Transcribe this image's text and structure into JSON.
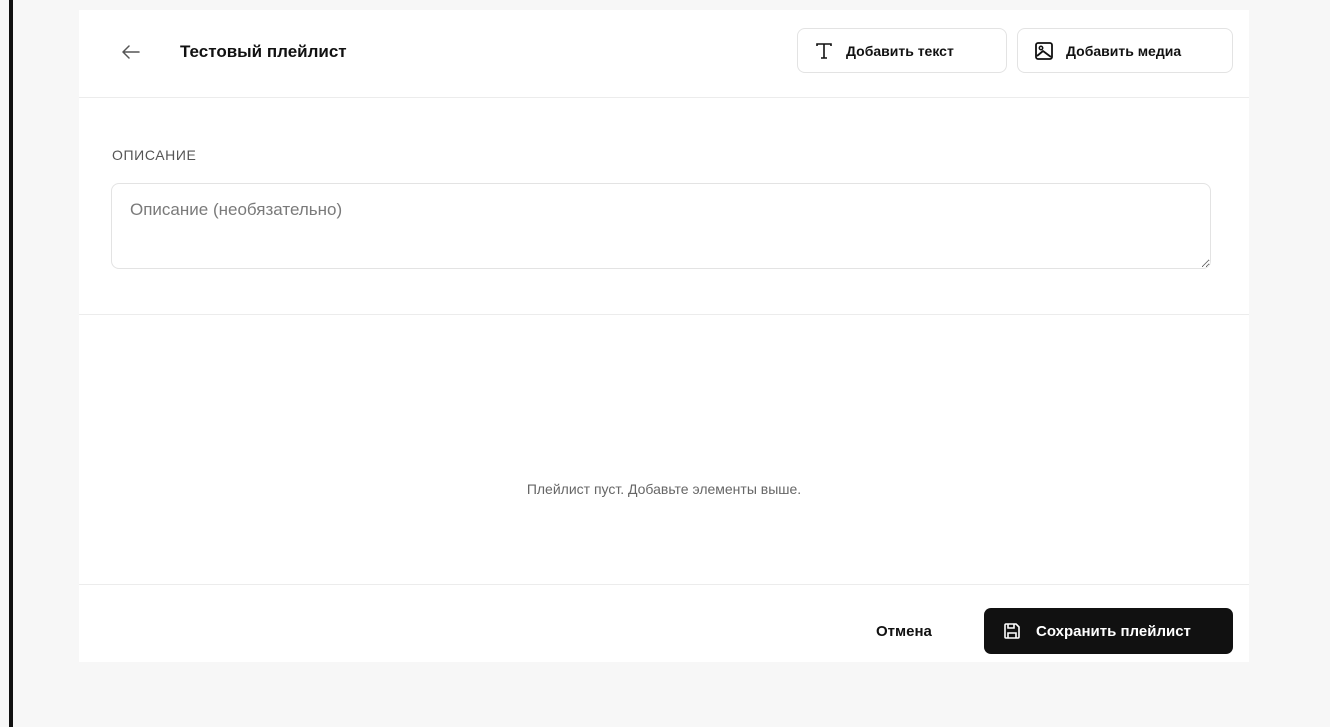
{
  "header": {
    "title": "Тестовый плейлист",
    "back_icon": "arrow-left-icon",
    "add_text_label": "Добавить текст",
    "add_text_icon": "type-icon",
    "add_media_label": "Добавить медиа",
    "add_media_icon": "image-icon"
  },
  "description": {
    "label": "Описание",
    "placeholder": "Описание (необязательно)",
    "value": ""
  },
  "playlist": {
    "empty_message": "Плейлист пуст. Добавьте элементы выше."
  },
  "footer": {
    "cancel_label": "Отмена",
    "save_label": "Сохранить плейлист",
    "save_icon": "save-icon"
  },
  "colors": {
    "primary_button": "#111111",
    "background": "#f7f7f7",
    "panel": "#ffffff",
    "border": "#e3e3e3"
  }
}
